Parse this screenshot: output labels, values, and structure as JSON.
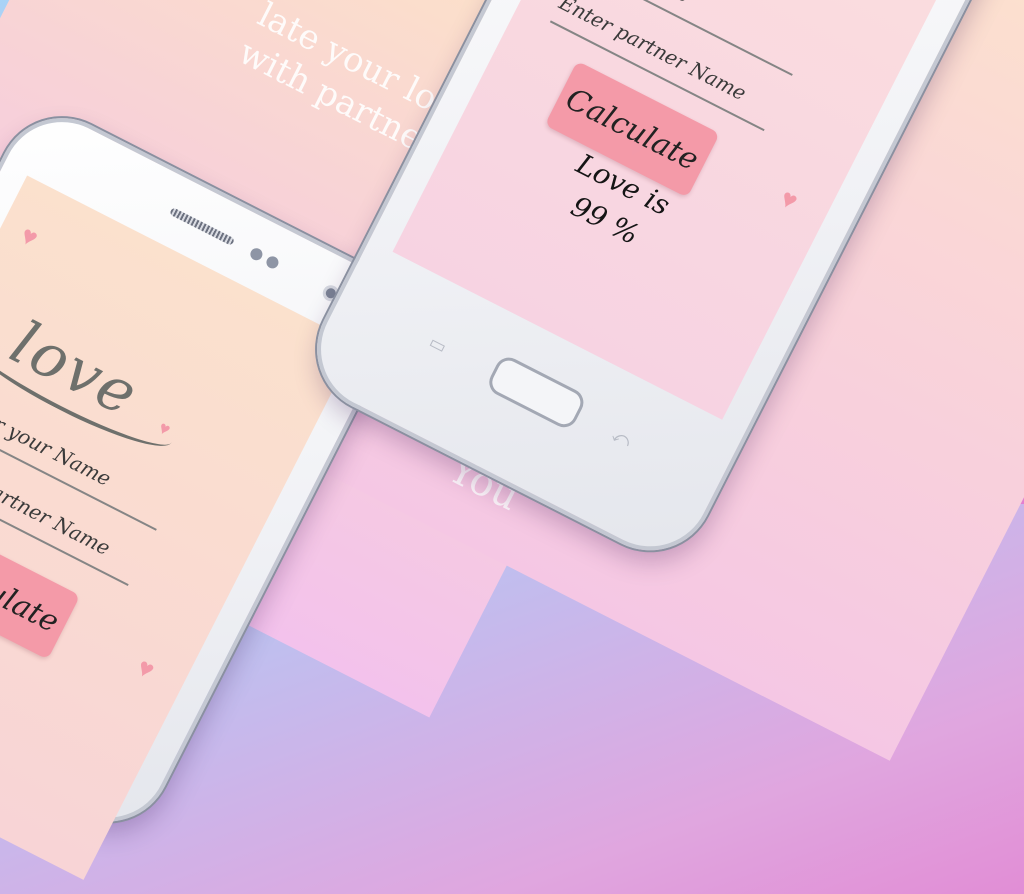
{
  "heading": {
    "line1": "late your love",
    "line2": "with partner"
  },
  "footer_text": "You",
  "phone_left": {
    "logo": "love",
    "name_placeholder": "Enter your Name",
    "partner_placeholder": "Enter partner Name",
    "calculate_label": "Calculate"
  },
  "phone_right": {
    "name_placeholder": "your Name",
    "partner_placeholder": "Enter partner Name",
    "calculate_label": "Calculate",
    "result_label": "Love is",
    "result_value": "99 %"
  },
  "icons": {
    "heart": "♥",
    "back": "⤺",
    "recent": "▭"
  },
  "colors": {
    "button": "#f49aa8",
    "heart": "#f39aa9",
    "panel_top": "#fde4c6",
    "panel_bottom": "#f3c2ec"
  }
}
